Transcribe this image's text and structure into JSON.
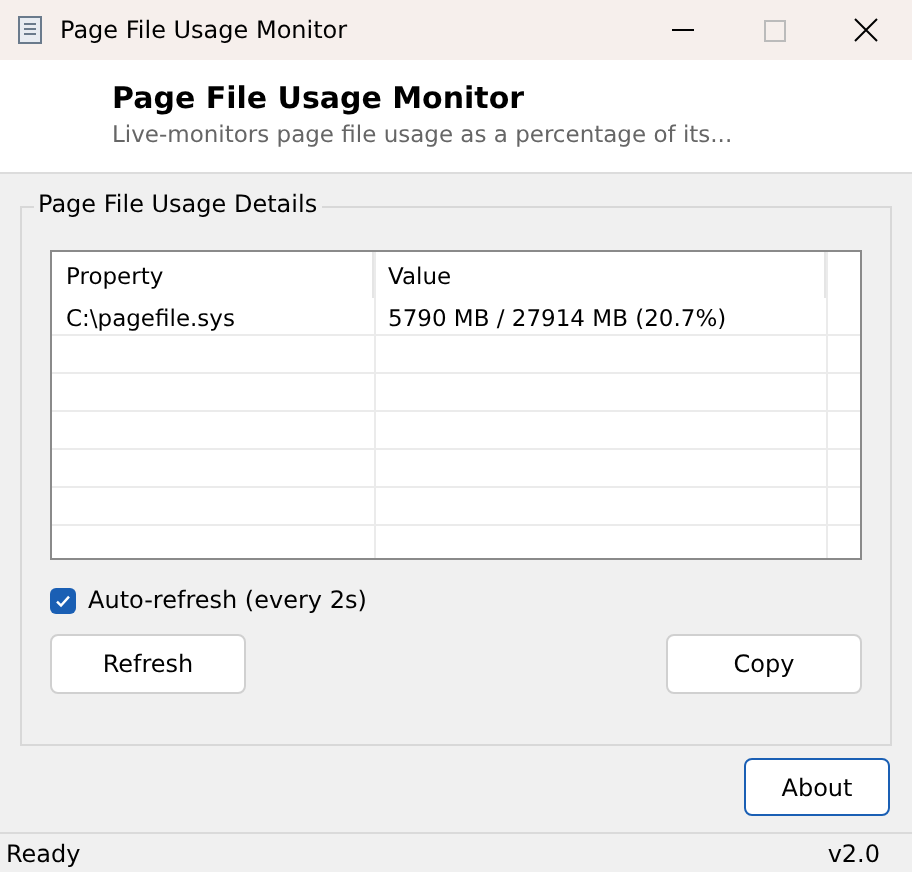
{
  "window": {
    "title": "Page File Usage Monitor"
  },
  "header": {
    "title": "Page File Usage Monitor",
    "subtitle": "Live-monitors page file usage as a percentage of its..."
  },
  "group": {
    "title": "Page File Usage Details",
    "table": {
      "columns": [
        "Property",
        "Value"
      ],
      "rows": [
        {
          "cells": [
            "C:\\pagefile.sys",
            "5790 MB / 27914 MB (20.7%)"
          ]
        }
      ]
    },
    "auto_refresh": {
      "label": "Auto-refresh (every 2s)",
      "checked": true
    },
    "buttons": [
      {
        "label": "Refresh",
        "focused": false
      },
      {
        "label": "Copy",
        "focused": false
      }
    ]
  },
  "about_button": {
    "label": "About",
    "focused": true
  },
  "status_bar": {
    "status": "Ready",
    "version": "v2.0"
  }
}
